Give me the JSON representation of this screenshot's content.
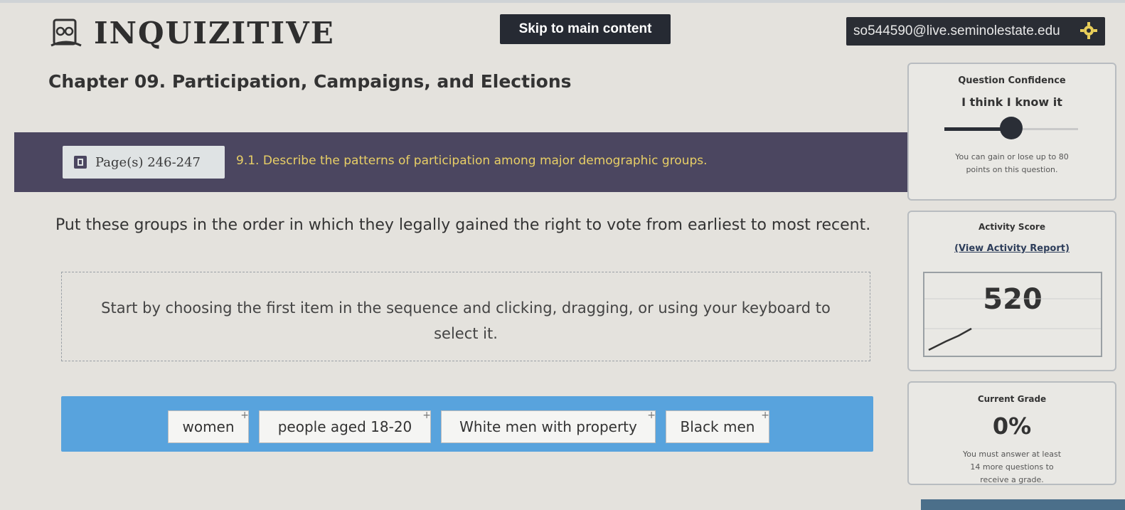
{
  "header": {
    "logo_text": "INQUIZITIVE",
    "skip_link": "Skip to main content",
    "user_email": "so544590@live.seminolestate.edu"
  },
  "chapter": {
    "title": "Chapter 09. Participation, Campaigns, and Elections"
  },
  "objective": {
    "pages_label": "Page(s) 246-247",
    "text": "9.1. Describe the patterns of participation among major demographic groups."
  },
  "question": {
    "prompt": "Put these groups in the order in which they legally gained the right to vote from earliest to most recent.",
    "instruction": "Start by choosing the first item in the sequence and clicking, dragging, or using your keyboard to select it.",
    "choices": [
      "women",
      "people aged 18-20",
      "White men with property",
      "Black men"
    ]
  },
  "confidence": {
    "title": "Question Confidence",
    "value_label": "I think I know it",
    "level_percent": 50,
    "note": "You can gain or lose up to 80 points on this question."
  },
  "activity": {
    "title": "Activity Score",
    "link": "(View Activity Report)",
    "score": "520"
  },
  "grade": {
    "title": "Current Grade",
    "value": "0%",
    "note": "You must answer at least 14 more questions to receive a grade."
  },
  "colors": {
    "band": "#4b4660",
    "answer_bar": "#58a3dd",
    "objective_text": "#e8cf66",
    "dark": "#262a33"
  }
}
